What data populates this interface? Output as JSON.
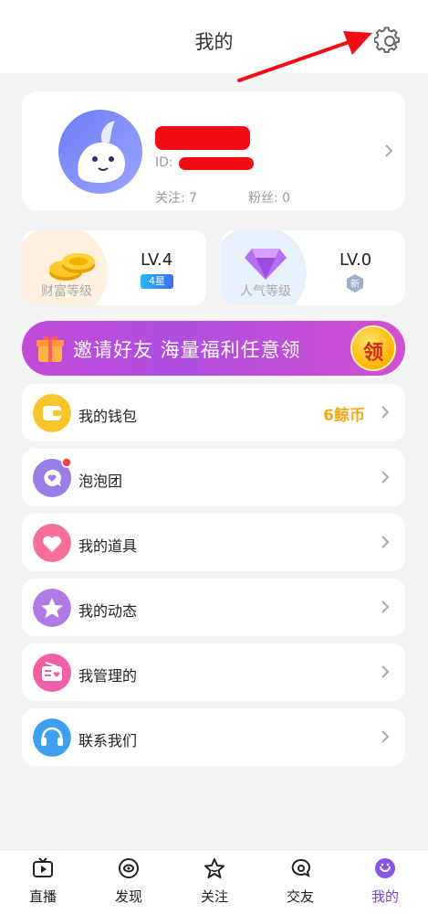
{
  "header": {
    "title": "我的"
  },
  "profile": {
    "id_label": "ID:",
    "following_label": "关注: 7",
    "fans_label": "粉丝: 0"
  },
  "levels": {
    "wealth": {
      "name": "财富等级",
      "value": "LV.4",
      "badge": "4星"
    },
    "popularity": {
      "name": "人气等级",
      "value": "LV.0",
      "badge": "新"
    }
  },
  "banner": {
    "text": "邀请好友 海量福利任意领",
    "button": "领"
  },
  "menu": [
    {
      "label": "我的钱包",
      "value": "6鲸币",
      "icon": "wallet-icon",
      "color": "#f7c52c"
    },
    {
      "label": "泡泡团",
      "value": "",
      "icon": "bubble-group-icon",
      "color": "#9b7de8"
    },
    {
      "label": "我的道具",
      "value": "",
      "icon": "heart-icon",
      "color": "#f56f98"
    },
    {
      "label": "我的动态",
      "value": "",
      "icon": "star-icon",
      "color": "#b07be6"
    },
    {
      "label": "我管理的",
      "value": "",
      "icon": "radio-icon",
      "color": "#f05fa8"
    },
    {
      "label": "联系我们",
      "value": "",
      "icon": "headset-icon",
      "color": "#3fa0f0"
    }
  ],
  "tabs": [
    {
      "label": "直播",
      "icon": "live-tv-icon"
    },
    {
      "label": "发现",
      "icon": "eye-icon"
    },
    {
      "label": "关注",
      "icon": "star-outline-icon"
    },
    {
      "label": "交友",
      "icon": "chat-icon"
    },
    {
      "label": "我的",
      "icon": "profile-icon"
    }
  ],
  "colors": {
    "accent": "#7a3fd8",
    "coin": "#f2a91a",
    "banner": "#c24bd8",
    "annotation": "#f20d16"
  }
}
